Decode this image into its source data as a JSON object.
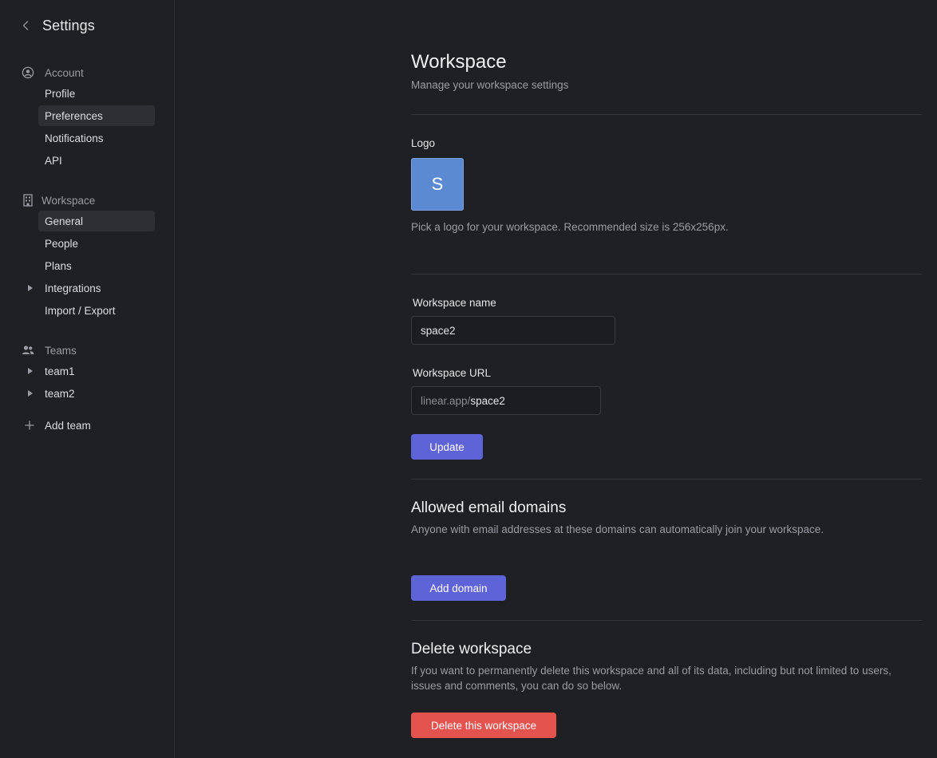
{
  "sidebar": {
    "title": "Settings",
    "account": {
      "heading": "Account",
      "items": [
        {
          "label": "Profile"
        },
        {
          "label": "Preferences"
        },
        {
          "label": "Notifications"
        },
        {
          "label": "API"
        }
      ]
    },
    "workspace": {
      "heading": "Workspace",
      "items": [
        {
          "label": "General"
        },
        {
          "label": "People"
        },
        {
          "label": "Plans"
        },
        {
          "label": "Integrations"
        },
        {
          "label": "Import / Export"
        }
      ]
    },
    "teams": {
      "heading": "Teams",
      "items": [
        {
          "label": "team1"
        },
        {
          "label": "team2"
        }
      ],
      "add_label": "Add team"
    }
  },
  "main": {
    "title": "Workspace",
    "subtitle": "Manage your workspace settings",
    "logo": {
      "label": "Logo",
      "letter": "S",
      "help": "Pick a logo for your workspace. Recommended size is 256x256px."
    },
    "name_field": {
      "label": "Workspace name",
      "value": "space2"
    },
    "url_field": {
      "label": "Workspace URL",
      "prefix": "linear.app/",
      "value": "space2"
    },
    "update_button": "Update",
    "domains": {
      "title": "Allowed email domains",
      "description": "Anyone with email addresses at these domains can automatically join your workspace.",
      "button": "Add domain"
    },
    "delete": {
      "title": "Delete workspace",
      "description": "If you want to permanently delete this workspace and all of its data, including but not limited to users, issues and comments, you can do so below.",
      "button": "Delete this workspace"
    }
  },
  "colors": {
    "background": "#1f2023",
    "primary": "#5e63d8",
    "danger": "#e5534f",
    "logo": "#5b8ad2"
  }
}
